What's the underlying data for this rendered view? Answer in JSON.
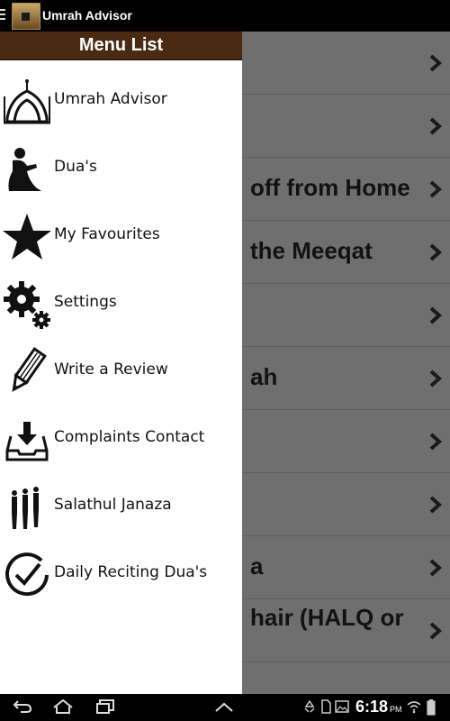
{
  "app": {
    "title": "Umrah Advisor",
    "menu_icon": "hamburger-icon",
    "logo_icon": "kaaba-logo-icon"
  },
  "drawer": {
    "header": "Menu List",
    "header_color": "#4a2a12",
    "items": [
      {
        "label": "Umrah Advisor",
        "icon": "mosque-dome-icon"
      },
      {
        "label": "Dua's",
        "icon": "praying-person-icon"
      },
      {
        "label": "My Favourites",
        "icon": "star-icon"
      },
      {
        "label": "Settings",
        "icon": "gear-icon"
      },
      {
        "label": "Write a Review",
        "icon": "pencil-icon"
      },
      {
        "label": "Complaints Contact",
        "icon": "inbox-download-icon"
      },
      {
        "label": "Salathul Janaza",
        "icon": "prayer-row-icon"
      },
      {
        "label": "Daily Reciting Dua's",
        "icon": "clock-check-icon"
      }
    ]
  },
  "content": {
    "rows": [
      {
        "text": ""
      },
      {
        "text": ""
      },
      {
        "text": "off from Home"
      },
      {
        "text": "the Meeqat"
      },
      {
        "text": ""
      },
      {
        "text": "ah"
      },
      {
        "text": ""
      },
      {
        "text": ""
      },
      {
        "text": "a"
      },
      {
        "text": "hair (HALQ or"
      },
      {
        "text": ""
      }
    ],
    "row_icon": "chevron-right-icon"
  },
  "status": {
    "time": "6:18",
    "ampm": "PM",
    "icons": [
      "recycle-icon",
      "sd-card-icon",
      "image-icon",
      "wifi-icon",
      "battery-icon"
    ]
  },
  "navigation": {
    "icons": [
      "back-icon",
      "home-icon",
      "recent-apps-icon",
      "up-chevron-icon"
    ]
  }
}
